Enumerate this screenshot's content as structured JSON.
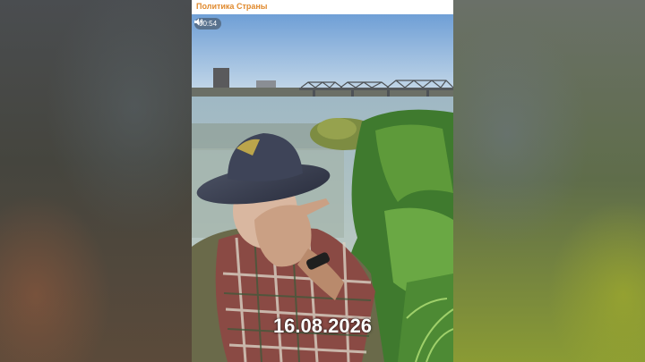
{
  "post": {
    "channel_name": "Политика Страны",
    "video": {
      "duration": "00:54",
      "overlay_date": "16.08.2026",
      "sound_icon": "speaker-icon"
    }
  },
  "colors": {
    "channel_accent": "#e08a2e",
    "post_background": "#ffffff"
  }
}
